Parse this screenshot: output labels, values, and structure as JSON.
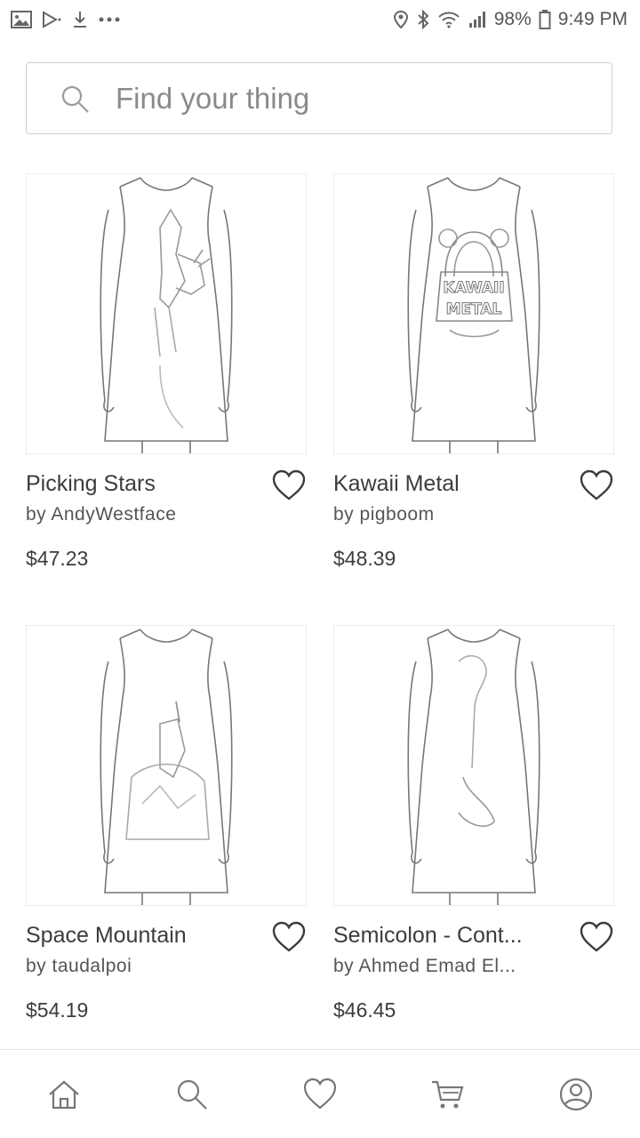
{
  "status_bar": {
    "battery": "98%",
    "time": "9:49 PM",
    "icons": [
      "gallery-icon",
      "play-store-icon",
      "download-icon",
      "more-icon",
      "location-icon",
      "bluetooth-icon",
      "wifi-icon",
      "signal-icon",
      "battery-icon"
    ]
  },
  "search": {
    "placeholder": "Find your thing",
    "icon": "search-icon"
  },
  "products": [
    {
      "title": "Picking Stars",
      "artist": "by AndyWestface",
      "price": "$47.23",
      "image_alt": "Picking Stars dress"
    },
    {
      "title": "Kawaii Metal",
      "artist": "by pigboom",
      "price": "$48.39",
      "image_alt": "Kawaii Metal dress",
      "print_text": "KAWAII METAL"
    },
    {
      "title": "Space Mountain",
      "artist": "by taudalpoi",
      "price": "$54.19",
      "image_alt": "Space Mountain dress"
    },
    {
      "title": "Semicolon - Cont...",
      "artist": "by Ahmed Emad El...",
      "price": "$46.45",
      "image_alt": "Semicolon dress"
    }
  ],
  "bottom_nav": {
    "items": [
      "home-icon",
      "search-icon",
      "favorites-icon",
      "cart-icon",
      "account-icon"
    ]
  },
  "colors": {
    "background": "#ffffff",
    "text": "#3c3c3c",
    "border": "#cfcfcf",
    "icon": "#777777"
  }
}
